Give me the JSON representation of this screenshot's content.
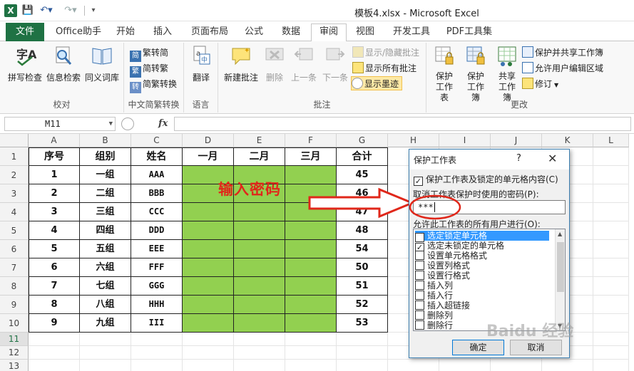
{
  "title": {
    "window_title": "模板4.xlsx - Microsoft Excel",
    "app_icon": "X",
    "quick_access": [
      "save-icon",
      "undo-icon",
      "redo-icon",
      "customize-icon"
    ]
  },
  "tabs": [
    {
      "label": "文件"
    },
    {
      "label": "Office助手"
    },
    {
      "label": "开始"
    },
    {
      "label": "插入"
    },
    {
      "label": "页面布局"
    },
    {
      "label": "公式"
    },
    {
      "label": "数据"
    },
    {
      "label": "审阅"
    },
    {
      "label": "视图"
    },
    {
      "label": "开发工具"
    },
    {
      "label": "PDF工具集"
    }
  ],
  "ribbon": {
    "proof": {
      "label": "校对",
      "spell": "拼写检查",
      "research": "信息检索",
      "thesaurus": "同义词库"
    },
    "chinese": {
      "label": "中文简繁转换",
      "t2s": "繁转简",
      "s2t": "简转繁",
      "convert": "简繁转换"
    },
    "language": {
      "label": "语言",
      "translate": "翻译"
    },
    "comments": {
      "label": "批注",
      "new": "新建批注",
      "delete": "删除",
      "prev": "上一条",
      "next": "下一条",
      "show_hide": "显示/隐藏批注",
      "show_all": "显示所有批注",
      "show_ink": "显示墨迹"
    },
    "changes": {
      "label": "更改",
      "protect_sheet": "保护工作表",
      "protect_book": "保护工作簿",
      "share_book": "共享工作簿",
      "protect_share": "保护并共享工作簿",
      "allow_edit": "允许用户编辑区域",
      "track": "修订"
    }
  },
  "formula_bar": {
    "name_box": "M11",
    "fx": "fx",
    "value": ""
  },
  "columns": [
    "A",
    "B",
    "C",
    "D",
    "E",
    "F",
    "G",
    "H",
    "I",
    "J",
    "K",
    "L"
  ],
  "rows": [
    "1",
    "2",
    "3",
    "4",
    "5",
    "6",
    "7",
    "8",
    "9",
    "10",
    "11",
    "12",
    "13"
  ],
  "table": {
    "headers": [
      "序号",
      "组别",
      "姓名",
      "一月",
      "二月",
      "三月",
      "合计"
    ],
    "data": [
      [
        "1",
        "一组",
        "AAA",
        "",
        "",
        "",
        "45"
      ],
      [
        "2",
        "二组",
        "BBB",
        "",
        "",
        "",
        "46"
      ],
      [
        "3",
        "三组",
        "CCC",
        "",
        "",
        "",
        "47"
      ],
      [
        "4",
        "四组",
        "DDD",
        "",
        "",
        "",
        "48"
      ],
      [
        "5",
        "五组",
        "EEE",
        "",
        "",
        "",
        "54"
      ],
      [
        "6",
        "六组",
        "FFF",
        "",
        "",
        "",
        "50"
      ],
      [
        "7",
        "七组",
        "GGG",
        "",
        "",
        "",
        "51"
      ],
      [
        "8",
        "八组",
        "HHH",
        "",
        "",
        "",
        "52"
      ],
      [
        "9",
        "九组",
        "III",
        "",
        "",
        "",
        "53"
      ]
    ]
  },
  "annotation": {
    "text": "输入密码",
    "color": "#e0271a"
  },
  "dialog": {
    "title": "保护工作表",
    "help": "?",
    "close": "✕",
    "protect_label": "保护工作表及锁定的单元格内容(C)",
    "protect_checked": true,
    "password_label": "取消工作表保护时使用的密码(P):",
    "password_value": "***",
    "allow_label": "允许此工作表的所有用户进行(O):",
    "permissions": [
      {
        "label": "选定锁定单元格",
        "checked": true,
        "selected": true
      },
      {
        "label": "选定未锁定的单元格",
        "checked": true,
        "selected": false
      },
      {
        "label": "设置单元格格式",
        "checked": false,
        "selected": false
      },
      {
        "label": "设置列格式",
        "checked": false,
        "selected": false
      },
      {
        "label": "设置行格式",
        "checked": false,
        "selected": false
      },
      {
        "label": "插入列",
        "checked": false,
        "selected": false
      },
      {
        "label": "插入行",
        "checked": false,
        "selected": false
      },
      {
        "label": "插入超链接",
        "checked": false,
        "selected": false
      },
      {
        "label": "删除列",
        "checked": false,
        "selected": false
      },
      {
        "label": "删除行",
        "checked": false,
        "selected": false
      }
    ],
    "ok": "确定",
    "cancel": "取消"
  },
  "watermark": "Baidu 经验",
  "colors": {
    "excel_green": "#1f7244",
    "fill_green": "#92d050",
    "annotation_red": "#e0271a",
    "selection_blue": "#3399ff"
  }
}
